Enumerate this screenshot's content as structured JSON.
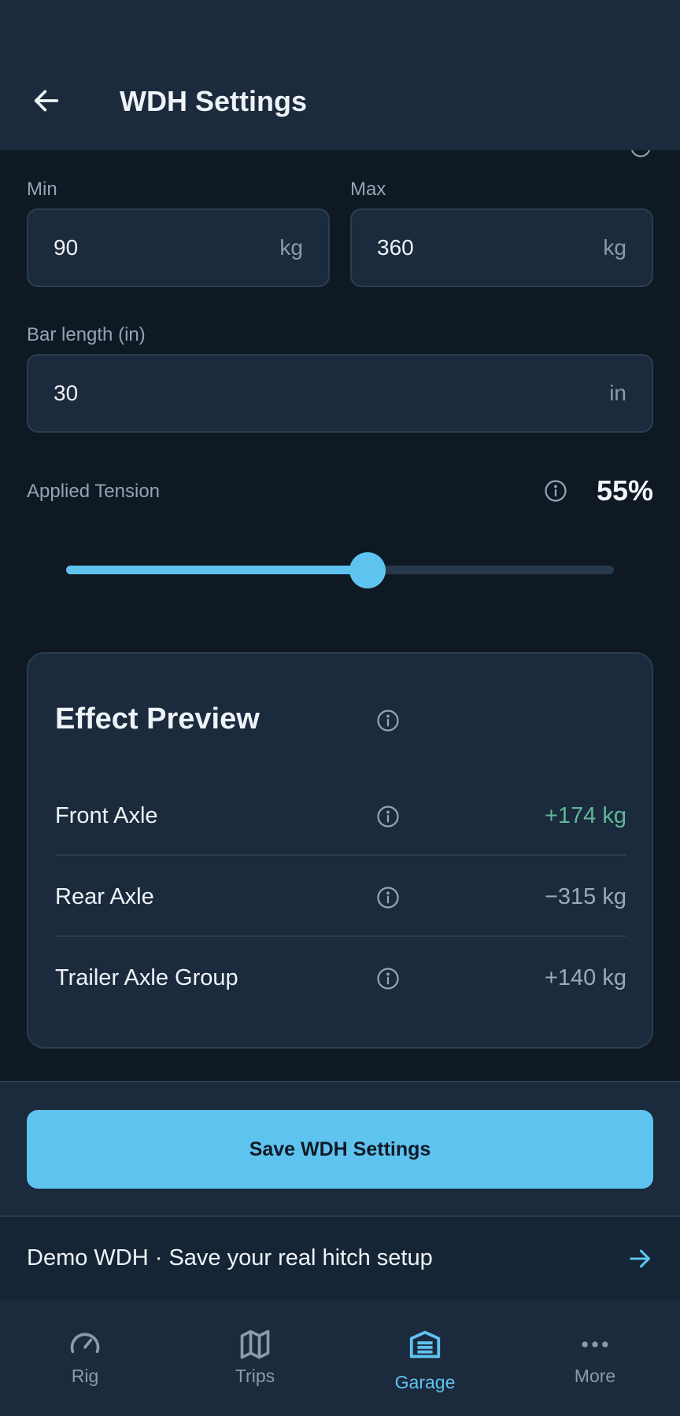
{
  "header": {
    "title": "WDH Settings"
  },
  "capacity": {
    "min_label": "Min",
    "min_value": "90",
    "min_unit": "kg",
    "max_label": "Max",
    "max_value": "360",
    "max_unit": "kg"
  },
  "bar_length": {
    "label": "Bar length (in)",
    "value": "30",
    "unit": "in"
  },
  "tension": {
    "label": "Applied Tension",
    "value_text": "55%",
    "level": 0.55
  },
  "preview": {
    "title": "Effect Preview",
    "rows": [
      {
        "label": "Front Axle",
        "value": "+174 kg",
        "tone": "positive"
      },
      {
        "label": "Rear Axle",
        "value": "−315 kg",
        "tone": "neutral"
      },
      {
        "label": "Trailer Axle Group",
        "value": "+140 kg",
        "tone": "neutral"
      }
    ]
  },
  "actions": {
    "save_label": "Save WDH Settings"
  },
  "demo_banner": {
    "text": "Demo WDH · Save your real hitch setup"
  },
  "nav": {
    "items": [
      {
        "label": "Rig",
        "icon": "gauge-icon"
      },
      {
        "label": "Trips",
        "icon": "map-icon"
      },
      {
        "label": "Garage",
        "icon": "garage-icon",
        "active": true
      },
      {
        "label": "More",
        "icon": "more-dots-icon"
      }
    ]
  },
  "colors": {
    "accent": "#5fc3ef",
    "positive": "#62b59a",
    "surface": "#1b2a3c",
    "background": "#0f1923"
  }
}
